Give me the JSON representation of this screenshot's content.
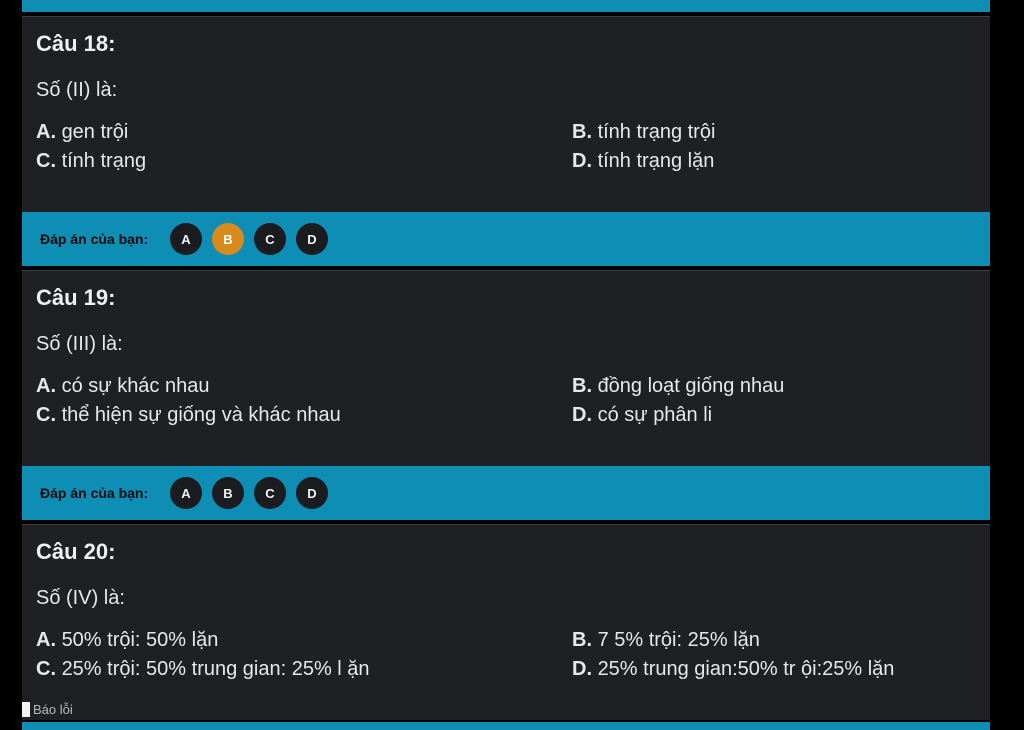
{
  "answer_label": "Đáp án của bạn:",
  "choices": [
    "A",
    "B",
    "C",
    "D"
  ],
  "colors": {
    "accent_bar": "#0e8db5",
    "selected": "#d98a1c",
    "card_bg": "#1f2023"
  },
  "questions": [
    {
      "title": "Câu 18:",
      "stem": "Số (II) là:",
      "options": [
        {
          "letter": "A.",
          "text": "gen trội"
        },
        {
          "letter": "B.",
          "text": "tính trạng trội"
        },
        {
          "letter": "C.",
          "text": "tính trạng"
        },
        {
          "letter": "D.",
          "text": "tính trạng lặn"
        }
      ],
      "selected": "B"
    },
    {
      "title": "Câu 19:",
      "stem": "Số (III) là:",
      "options": [
        {
          "letter": "A.",
          "text": "có sự khác nhau"
        },
        {
          "letter": "B.",
          "text": "đồng loạt giống nhau"
        },
        {
          "letter": "C.",
          "text": "thể hiện sự giống và khác nhau"
        },
        {
          "letter": "D.",
          "text": "có sự phân li"
        }
      ],
      "selected": ""
    },
    {
      "title": "Câu 20:",
      "stem": "Số (IV) là:",
      "options": [
        {
          "letter": "A.",
          "text": "50% trội: 50% lặn"
        },
        {
          "letter": "B.",
          "text": "7 5% trội: 25% lặn"
        },
        {
          "letter": "C.",
          "text": "25% trội: 50% trung gian: 25% l ặn"
        },
        {
          "letter": "D.",
          "text": "25% trung gian:50% tr ội:25% lặn"
        }
      ],
      "selected": ""
    }
  ],
  "report_label": "Báo lỗi"
}
